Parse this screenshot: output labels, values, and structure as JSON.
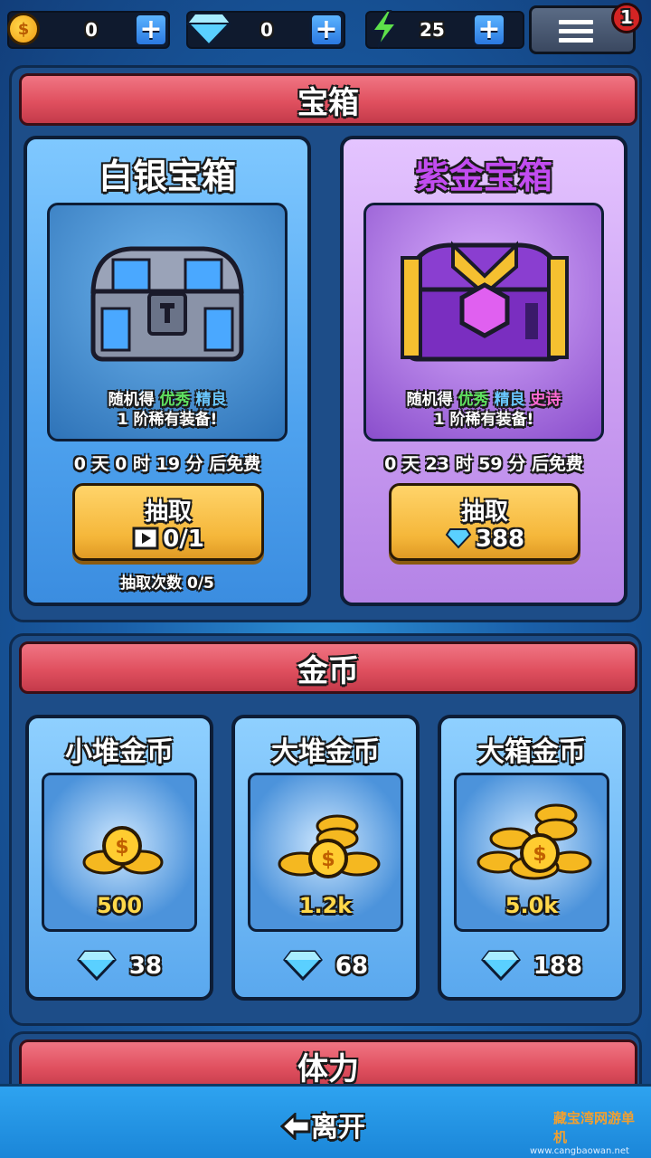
{
  "topbar": {
    "coins": "0",
    "gems": "0",
    "energy": "25",
    "notification_count": "1"
  },
  "chests_section": {
    "title": "宝箱",
    "silver": {
      "title": "白银宝箱",
      "desc_prefix": "随机得",
      "rarity1": "优秀",
      "rarity2": "精良",
      "desc_line2": "1 阶稀有装备!",
      "timer": "0 天 0 时 19 分 后免费",
      "button_label": "抽取",
      "button_cost": "0/1",
      "draw_count": "抽取次数 0/5"
    },
    "purple": {
      "title": "紫金宝箱",
      "desc_prefix": "随机得",
      "rarity1": "优秀",
      "rarity2": "精良",
      "rarity3": "史诗",
      "desc_line2": "1 阶稀有装备!",
      "timer": "0 天 23 时 59 分 后免费",
      "button_label": "抽取",
      "button_cost": "388"
    }
  },
  "gold_section": {
    "title": "金币",
    "items": [
      {
        "title": "小堆金币",
        "amount": "500",
        "price": "38"
      },
      {
        "title": "大堆金币",
        "amount": "1.2k",
        "price": "68"
      },
      {
        "title": "大箱金币",
        "amount": "5.0k",
        "price": "188"
      }
    ]
  },
  "stamina_section": {
    "title": "体力"
  },
  "bottom": {
    "leave_label": "离开",
    "watermark_line1": "藏宝湾网游单机",
    "watermark_line2": "www.cangbaowan.net"
  },
  "colors": {
    "header_red": "#e0505f",
    "silver_card": "#4fa3ef",
    "purple_card": "#c89af0",
    "button_gold": "#f5b73a",
    "bottom_bar": "#1b86d8"
  }
}
